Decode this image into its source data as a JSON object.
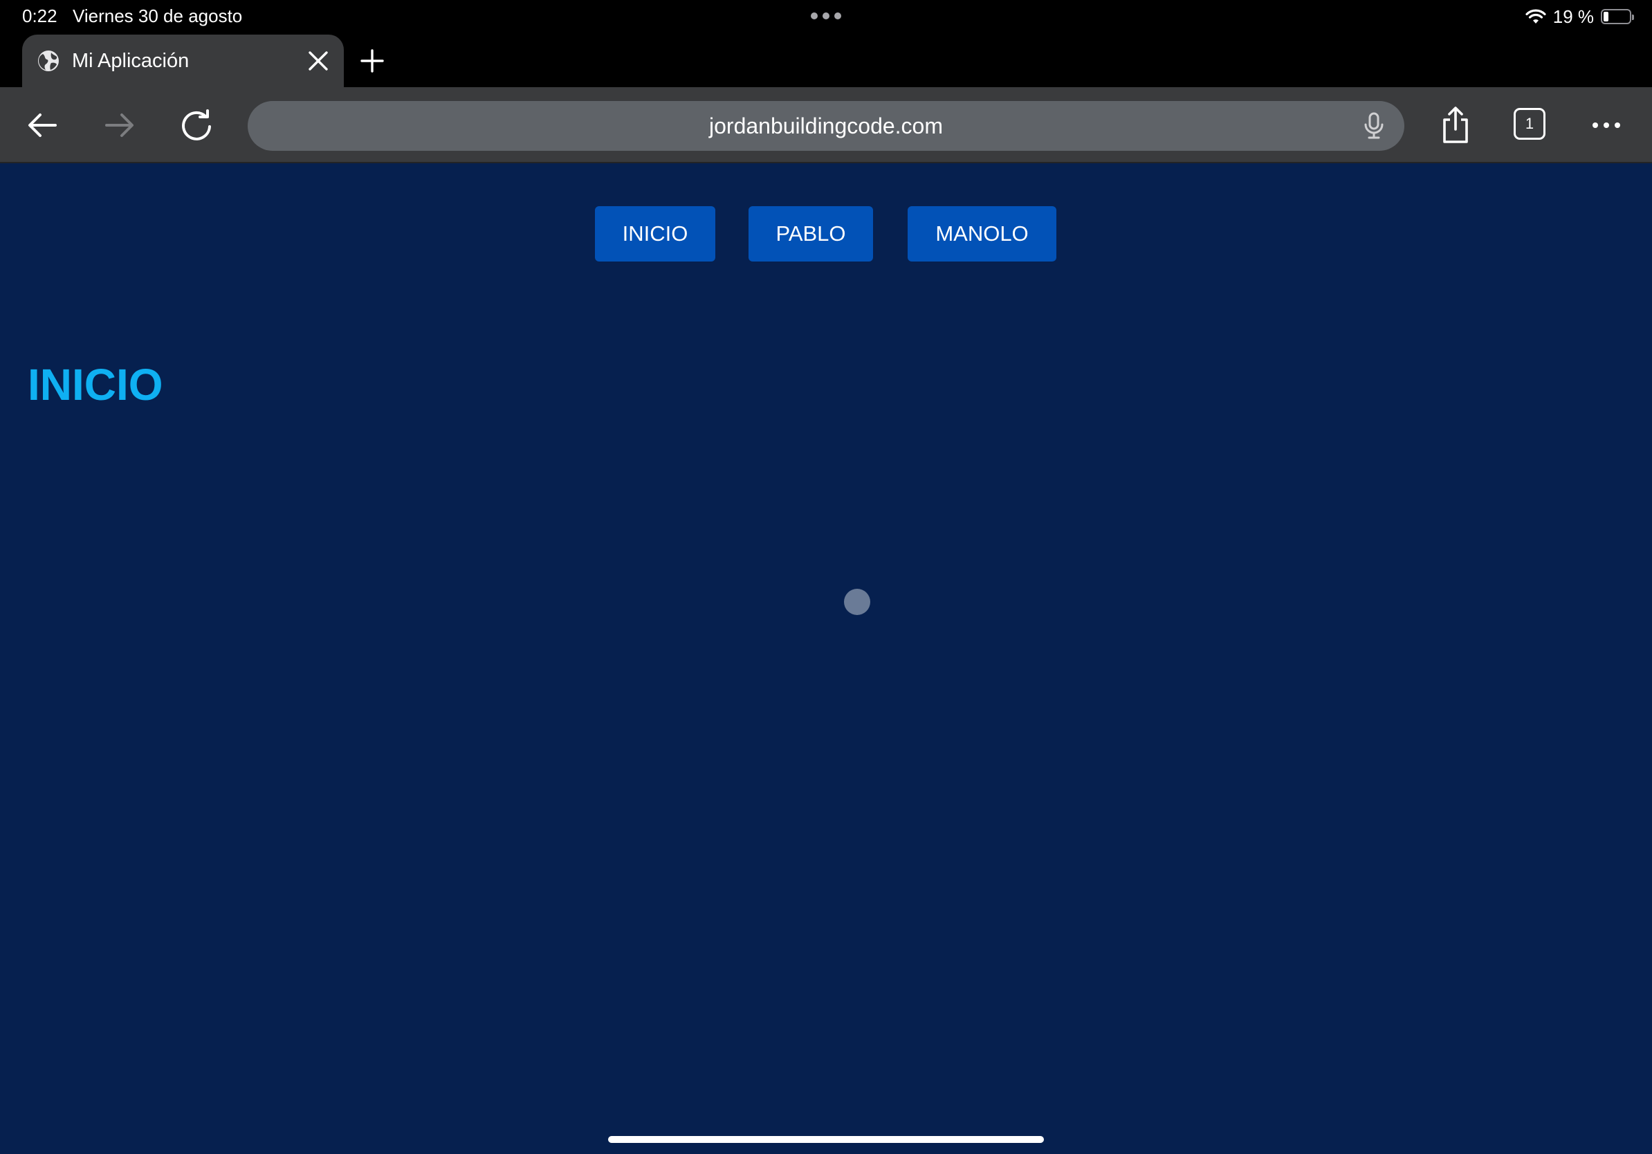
{
  "status_bar": {
    "time": "0:22",
    "date": "Viernes 30 de agosto",
    "battery_percent": "19 %",
    "battery_level": 0.19,
    "wifi_icon": "wifi-icon",
    "battery_icon": "battery-icon"
  },
  "tab_strip": {
    "tabs": [
      {
        "title": "Mi Aplicación",
        "favicon": "globe-icon",
        "active": true
      }
    ],
    "close_icon": "close-icon",
    "new_tab_icon": "plus-icon"
  },
  "toolbar": {
    "url": "jordanbuildingcode.com",
    "tab_count": "1",
    "back_icon": "back-arrow-icon",
    "forward_icon": "forward-arrow-icon",
    "reload_icon": "reload-icon",
    "mic_icon": "microphone-icon",
    "share_icon": "share-icon",
    "more_icon": "more-icon"
  },
  "page": {
    "nav": [
      "INICIO",
      "PABLO",
      "MANOLO"
    ],
    "heading": "INICIO"
  },
  "colors": {
    "page_background": "#06204f",
    "nav_button": "#0252b7",
    "heading": "#0fb0f2",
    "chrome": "#3a3b3d",
    "url_bar": "#5f6368"
  }
}
